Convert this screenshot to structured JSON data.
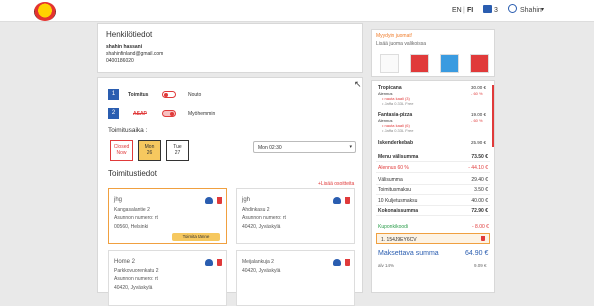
{
  "header": {
    "lang_en": "EN",
    "lang_sep": "|",
    "lang_fi": "FI",
    "cart_count": "3",
    "username": "Shahin"
  },
  "personal": {
    "title": "Henkilötiedot",
    "name": "shahin hassani",
    "email": "shahinfinland@gmail.com",
    "phone": "0400186020"
  },
  "delivery": {
    "step1": "1",
    "toimitus": "Toimitus",
    "nouto": "Nouto",
    "step2": "2",
    "asap": "ASAP",
    "later": "Myöhemmin",
    "time_label": "Toimitusaika :",
    "days": [
      {
        "l1": "Closed",
        "l2": "Now"
      },
      {
        "l1": "Mon",
        "l2": "26"
      },
      {
        "l1": "Tue",
        "l2": "27"
      }
    ],
    "time_select": "Mon 02:30"
  },
  "info": {
    "title": "Toimitustiedot",
    "add_link": "+Lisää osoitteita",
    "addresses": [
      {
        "name": "jhg",
        "street": "Kangasalantie 2",
        "extra": "Asunnon numero: rt",
        "city": "00560, Helsinki",
        "button": "Toimita tänne"
      },
      {
        "name": "jgh",
        "street": "Ahdinkasu 2",
        "extra": "Asunnon numero: rt",
        "city": "40420, Jyväskylä"
      },
      {
        "name": "Home 2",
        "street": "Parkkovuorenkatu 2",
        "extra": "Asunnon numero: rt",
        "city": "40420, Jyväskylä"
      },
      {
        "name": "",
        "street": "Meijalankuja 2",
        "extra": "",
        "city": "40420, Jyväskylä"
      }
    ]
  },
  "drinks": {
    "title": "Myydyin juomat!",
    "subtitle": "Lisää juoma valikoissa"
  },
  "cart": {
    "items": [
      {
        "name": "Tropicana",
        "sub": "Alennus",
        "price": "30.00 €",
        "disc": "- 60 %",
        "lines": [
          "• nauta kaali (3)",
          "• Jaffa 0.33L Free"
        ]
      },
      {
        "name": "Fantasia-pizza",
        "sub": "Alennus",
        "price": "19.00 €",
        "disc": "- 60 %",
        "lines": [
          "• nauta kaali (6)",
          "• Jaffa 0.33L Free"
        ]
      },
      {
        "name": "Iskenderkebab",
        "sub": "",
        "price": "25.90 €",
        "disc": "",
        "lines": []
      }
    ],
    "summary": [
      {
        "l": "Menu välisumma",
        "r": "73.50 €",
        "cls": "b"
      },
      {
        "l": "Alennus 60 %",
        "r": "- 44.10 €",
        "cls": "red"
      },
      {
        "l": "Välisumma",
        "r": "29.40 €",
        "cls": ""
      },
      {
        "l": "Toimitusmaksu",
        "r": "3.50 €",
        "cls": ""
      },
      {
        "l": "10 Kuljetusmaksu",
        "r": "40.00 €",
        "cls": ""
      },
      {
        "l": "Kokonaissumma",
        "r": "72.90 €",
        "cls": "b"
      }
    ],
    "coupon_label": "Kuponkikoodi",
    "coupon_value": "- 8.00 €",
    "coupon_code": "1. 154J9EY6CV",
    "pay_label": "Maksettava summa",
    "pay_value": "64.90 €",
    "vat_label": "alv 14%",
    "vat_value": "9.09 €"
  }
}
